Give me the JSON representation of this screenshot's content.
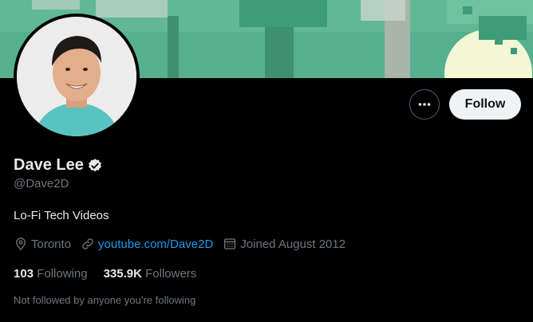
{
  "profile": {
    "name": "Dave Lee",
    "handle": "@Dave2D",
    "bio": "Lo-Fi Tech Videos",
    "location": "Toronto",
    "website": "youtube.com/Dave2D",
    "joined": "Joined August 2012",
    "following_count": "103",
    "following_label": "Following",
    "followers_count": "335.9K",
    "followers_label": "Followers",
    "followed_note": "Not followed by anyone you’re following"
  },
  "actions": {
    "follow_label": "Follow",
    "more_icon": "more-icon"
  },
  "icons": {
    "verified": "verified-badge-icon",
    "location": "location-pin-icon",
    "link": "link-icon",
    "calendar": "calendar-icon"
  },
  "colors": {
    "background": "#000000",
    "accent": "#1d9bf0",
    "text_primary": "#e7e9ea",
    "text_secondary": "#71767b",
    "follow_button_bg": "#eff3f4"
  }
}
